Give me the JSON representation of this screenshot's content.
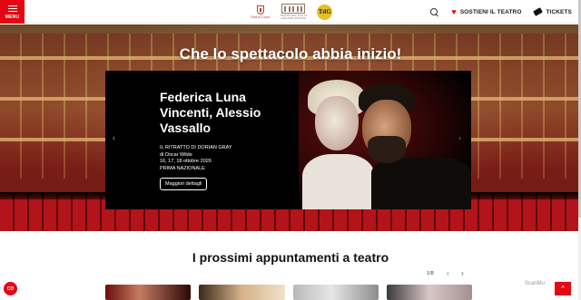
{
  "header": {
    "menu_label": "MENU",
    "city_logo_text": "Città di Lucca",
    "theatre_logo_text": "TEATRO DEL GIGLIO GIACOMO PUCCINI",
    "seal_text": "TdG",
    "support_label": "SOSTIENI IL TEATRO",
    "tickets_label": "TICKETS"
  },
  "hero": {
    "title": "Che lo spettacolo abbia inizio!",
    "slide": {
      "name": "Federica Luna Vincenti, Alessio Vassallo",
      "show": "IL RITRATTO DI DORIAN GRAY",
      "author": "di Oscar Wilde",
      "dates": "16, 17, 18 ottobre 2026",
      "note": "PRIMA NAZIONALE",
      "button_label": "Maggiori dettagli"
    },
    "prev_icon": "chevron-left-icon",
    "next_icon": "chevron-right-icon"
  },
  "upcoming": {
    "title": "I prossimi appuntamenti a teatro",
    "pager": "1/8",
    "prev": "‹",
    "next": "›"
  },
  "widgets": {
    "cookie_label": "CO",
    "watermark": "ScanMu",
    "top_icon": "^"
  },
  "colors": {
    "brand_red": "#e30613",
    "slide_bg": "#000000"
  }
}
